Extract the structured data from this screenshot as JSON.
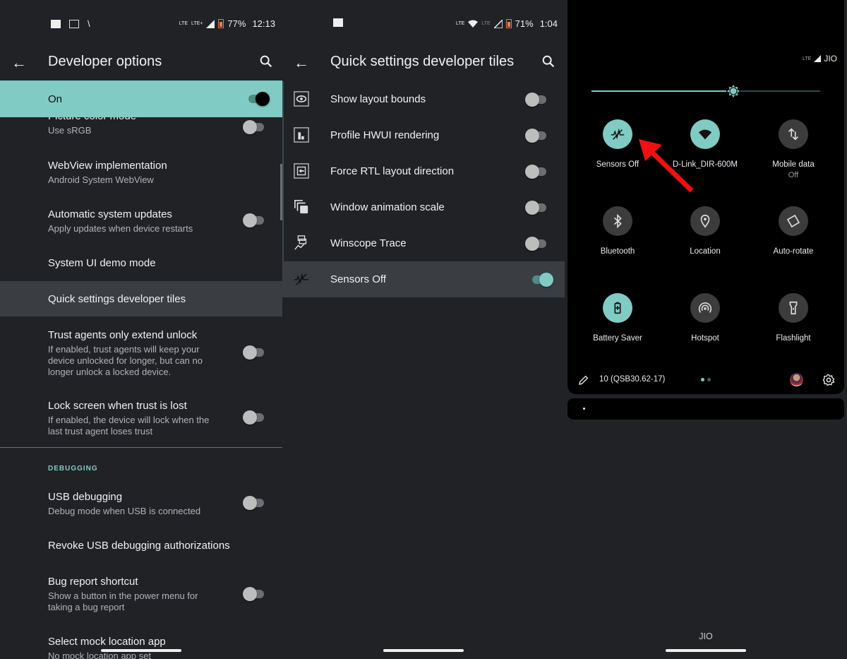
{
  "colors": {
    "accent": "#80cbc4",
    "background": "#202226",
    "highlight": "#3a3d42",
    "arrow": "#ee1111"
  },
  "panel1": {
    "status": {
      "battery": "77%",
      "time": "12:13",
      "net1": "LTE",
      "net2": "LTE+"
    },
    "title": "Developer options",
    "master_switch": {
      "label": "On",
      "state": true
    },
    "items": [
      {
        "title": "Picture color mode",
        "subtitle": "Use sRGB",
        "toggle": false
      },
      {
        "title": "WebView implementation",
        "subtitle": "Android System WebView"
      },
      {
        "title": "Automatic system updates",
        "subtitle": "Apply updates when device restarts",
        "toggle": false
      },
      {
        "title": "System UI demo mode"
      },
      {
        "title": "Quick settings developer tiles",
        "highlighted": true
      },
      {
        "title": "Trust agents only extend unlock",
        "subtitle": "If enabled, trust agents will keep your device unlocked for longer, but can no longer unlock a locked device.",
        "toggle": false
      },
      {
        "title": "Lock screen when trust is lost",
        "subtitle": "If enabled, the device will lock when the last trust agent loses trust",
        "toggle": false
      }
    ],
    "category": "DEBUGGING",
    "debug_items": [
      {
        "title": "USB debugging",
        "subtitle": "Debug mode when USB is connected",
        "toggle": false
      },
      {
        "title": "Revoke USB debugging authorizations"
      },
      {
        "title": "Bug report shortcut",
        "subtitle": "Show a button in the power menu for taking a bug report",
        "toggle": false
      },
      {
        "title": "Select mock location app",
        "subtitle": "No mock location app set"
      }
    ]
  },
  "panel2": {
    "status": {
      "battery": "71%",
      "time": "1:04",
      "net1": "LTE",
      "net2": "LTE"
    },
    "title": "Quick settings developer tiles",
    "tiles": [
      {
        "label": "Show layout bounds",
        "icon": "layout-bounds-icon",
        "toggle": false
      },
      {
        "label": "Profile HWUI rendering",
        "icon": "hwui-profile-icon",
        "toggle": false
      },
      {
        "label": "Force RTL layout direction",
        "icon": "rtl-icon",
        "toggle": false
      },
      {
        "label": "Window animation scale",
        "icon": "window-animation-icon",
        "toggle": false
      },
      {
        "label": "Winscope Trace",
        "icon": "winscope-icon",
        "toggle": false
      },
      {
        "label": "Sensors Off",
        "icon": "sensors-off-icon",
        "toggle": true,
        "highlighted": true
      }
    ]
  },
  "panel3": {
    "status": {
      "net": "LTE",
      "carrier": "JIO"
    },
    "brightness": 0.62,
    "tiles": [
      {
        "label": "Sensors Off",
        "icon": "sensors-off-icon",
        "active": true
      },
      {
        "label": "D-Link_DIR-600M",
        "icon": "wifi-icon",
        "active": true
      },
      {
        "label": "Mobile data",
        "sublabel": "Off",
        "icon": "mobile-data-icon",
        "active": false
      },
      {
        "label": "Bluetooth",
        "icon": "bluetooth-icon",
        "active": false
      },
      {
        "label": "Location",
        "icon": "location-icon",
        "active": false
      },
      {
        "label": "Auto-rotate",
        "icon": "auto-rotate-icon",
        "active": false
      },
      {
        "label": "Battery Saver",
        "icon": "battery-saver-icon",
        "active": true
      },
      {
        "label": "Hotspot",
        "icon": "hotspot-icon",
        "active": false
      },
      {
        "label": "Flashlight",
        "icon": "flashlight-icon",
        "active": false
      }
    ],
    "build": "10 (QSB30.62-17)",
    "page": 1,
    "pages": 2,
    "carrier_bottom": "JIO"
  }
}
